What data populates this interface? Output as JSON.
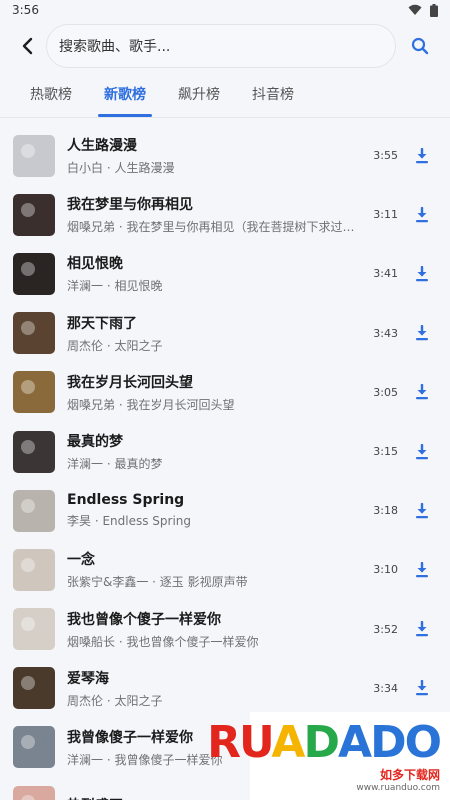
{
  "status": {
    "time": "3:56"
  },
  "search": {
    "placeholder": "搜索歌曲、歌手..."
  },
  "tabs": [
    {
      "label": "热歌榜"
    },
    {
      "label": "新歌榜",
      "active": true
    },
    {
      "label": "飙升榜"
    },
    {
      "label": "抖音榜"
    }
  ],
  "songs": [
    {
      "title": "人生路漫漫",
      "subtitle": "白小白 · 人生路漫漫",
      "duration": "3:55",
      "cover": "#c7c9cf"
    },
    {
      "title": "我在梦里与你再相见",
      "subtitle": "烟嗓兄弟 · 我在梦里与你再相见（我在菩提树下求过签）",
      "duration": "3:11",
      "cover": "#3a2f2d"
    },
    {
      "title": "相见恨晚",
      "subtitle": "洋澜一 · 相见恨晚",
      "duration": "3:41",
      "cover": "#2a2422"
    },
    {
      "title": "那天下雨了",
      "subtitle": "周杰伦 · 太阳之子",
      "duration": "3:43",
      "cover": "#5a4330"
    },
    {
      "title": "我在岁月长河回头望",
      "subtitle": "烟嗓兄弟 · 我在岁月长河回头望",
      "duration": "3:05",
      "cover": "#8a6a3a"
    },
    {
      "title": "最真的梦",
      "subtitle": "洋澜一 · 最真的梦",
      "duration": "3:15",
      "cover": "#3b3536"
    },
    {
      "title": "Endless Spring",
      "subtitle": "李昊 · Endless Spring",
      "duration": "3:18",
      "cover": "#b9b3ad"
    },
    {
      "title": "一念",
      "subtitle": "张紫宁&李鑫一 · 逐玉 影视原声带",
      "duration": "3:10",
      "cover": "#cfc6bd"
    },
    {
      "title": "我也曾像个傻子一样爱你",
      "subtitle": "烟嗓船长 · 我也曾像个傻子一样爱你",
      "duration": "3:52",
      "cover": "#d6cfc8"
    },
    {
      "title": "爱琴海",
      "subtitle": "周杰伦 · 太阳之子",
      "duration": "3:34",
      "cover": "#4a3a2c"
    },
    {
      "title": "我曾像傻子一样爱你",
      "subtitle": "洋澜一 · 我曾像傻子一样爱你",
      "duration": "",
      "cover": "#7a8390"
    },
    {
      "title": "热烈盛开",
      "subtitle": "",
      "duration": "",
      "cover": "#d9a9a0"
    }
  ],
  "watermark": {
    "logo": "RUANDADO",
    "text": "如多下载网",
    "url": "www.ruanduo.com"
  },
  "colors": {
    "accent": "#2f6fe0",
    "background": "#f4f6fa"
  }
}
